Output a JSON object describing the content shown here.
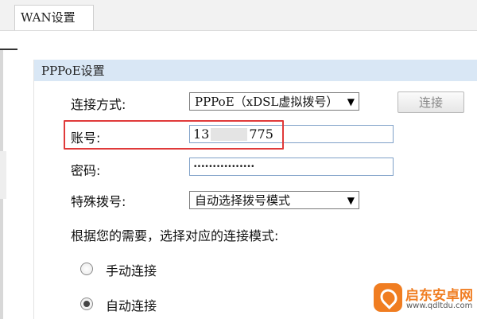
{
  "tab": {
    "label": "WAN设置"
  },
  "section": {
    "title": "PPPoE设置"
  },
  "connection": {
    "label": "连接方式:",
    "selected": "PPPoE（xDSL虚拟拨号）",
    "button_label": "连接"
  },
  "account": {
    "label": "账号:",
    "value_prefix": "13",
    "value_suffix": "775"
  },
  "password": {
    "label": "密码:",
    "masked_value": "••••••••••••••••"
  },
  "dialing": {
    "label": "特殊拨号:",
    "selected": "自动选择拨号模式"
  },
  "mode": {
    "prompt": "根据您的需要，选择对应的连接模式:",
    "options": [
      {
        "label": "手动连接",
        "checked": false
      },
      {
        "label": "自动连接",
        "checked": true
      }
    ]
  },
  "watermark": {
    "title": "启东安卓网",
    "url": "www.qdltdu.com"
  },
  "colors": {
    "highlight": "#e03a3a",
    "section_header": "#d9e7f5",
    "watermark": "#f07d21"
  }
}
